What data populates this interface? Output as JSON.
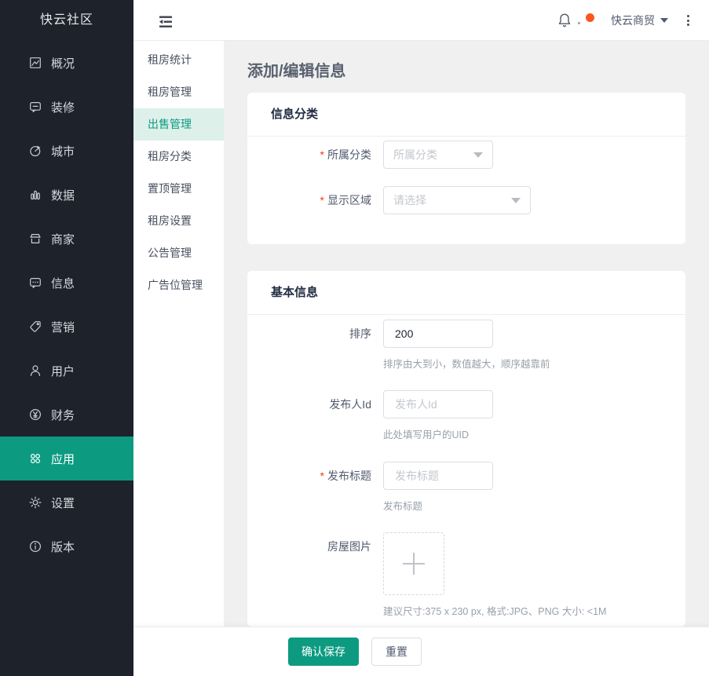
{
  "colors": {
    "accent": "#0c9b80",
    "accent_light": "#ddf0ea",
    "sidebar_bg": "#1e222b",
    "notification_dot": "#fb5521",
    "required_red": "#ed4014"
  },
  "logo": {
    "title": "快云社区"
  },
  "sidebar": {
    "items": [
      {
        "label": "概况",
        "icon": "overview-icon",
        "active": false
      },
      {
        "label": "装修",
        "icon": "decoration-icon",
        "active": false
      },
      {
        "label": "城市",
        "icon": "city-icon",
        "active": false
      },
      {
        "label": "数据",
        "icon": "data-icon",
        "active": false
      },
      {
        "label": "商家",
        "icon": "merchant-icon",
        "active": false
      },
      {
        "label": "信息",
        "icon": "message-icon",
        "active": false
      },
      {
        "label": "营销",
        "icon": "marketing-icon",
        "active": false
      },
      {
        "label": "用户",
        "icon": "user-icon",
        "active": false
      },
      {
        "label": "财务",
        "icon": "finance-icon",
        "active": false
      },
      {
        "label": "应用",
        "icon": "apps-icon",
        "active": true
      },
      {
        "label": "设置",
        "icon": "settings-icon",
        "active": false
      },
      {
        "label": "版本",
        "icon": "version-icon",
        "active": false
      }
    ]
  },
  "submenu": {
    "items": [
      {
        "label": "租房统计",
        "active": false
      },
      {
        "label": "租房管理",
        "active": false
      },
      {
        "label": "出售管理",
        "active": true
      },
      {
        "label": "租房分类",
        "active": false
      },
      {
        "label": "置顶管理",
        "active": false
      },
      {
        "label": "租房设置",
        "active": false
      },
      {
        "label": "公告管理",
        "active": false
      },
      {
        "label": "广告位管理",
        "active": false
      }
    ]
  },
  "topbar": {
    "company": "快云商贸"
  },
  "page": {
    "title": "添加/编辑信息"
  },
  "form": {
    "required_marker": "*",
    "card1": {
      "title": "信息分类",
      "category": {
        "label": "所属分类",
        "placeholder": "所属分类",
        "required": true
      },
      "region": {
        "label": "显示区域",
        "placeholder": "请选择",
        "required": true
      }
    },
    "card2": {
      "title": "基本信息",
      "sort": {
        "label": "排序",
        "value": "200",
        "hint": "排序由大到小，数值越大，顺序越靠前"
      },
      "publisher": {
        "label": "发布人Id",
        "placeholder": "发布人Id",
        "hint": "此处填写用户的UID"
      },
      "pub_title": {
        "label": "发布标题",
        "placeholder": "发布标题",
        "hint": "发布标题",
        "required": true
      },
      "house_img": {
        "label": "房屋图片",
        "hint": "建议尺寸:375 x 230 px, 格式:JPG、PNG 大小: <1M"
      }
    }
  },
  "footer": {
    "save_label": "确认保存",
    "reset_label": "重置"
  }
}
